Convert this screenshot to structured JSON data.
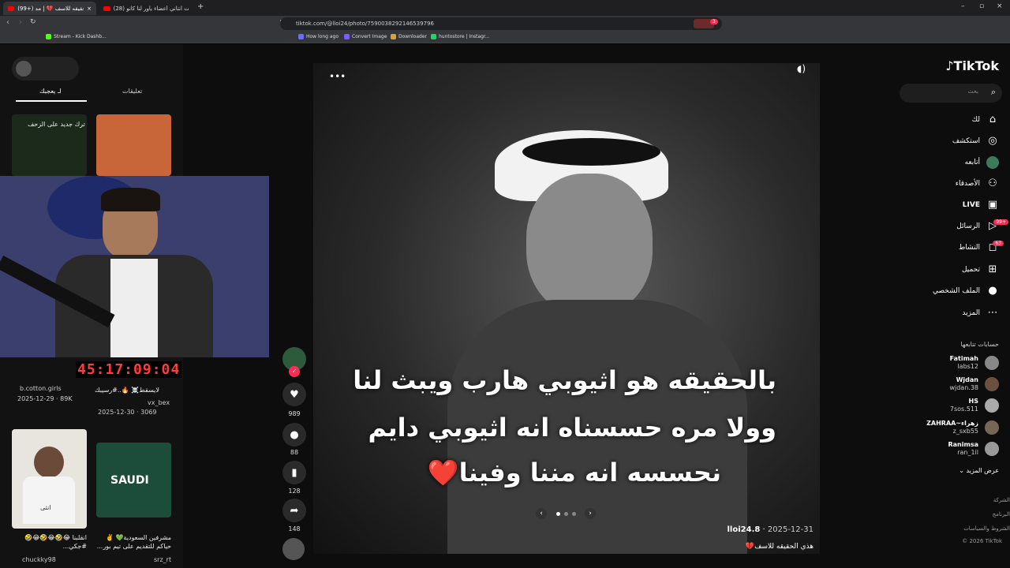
{
  "browser": {
    "tabs": [
      {
        "label": "(99+) هذي الحقيقه للاسف 💔 | مد...",
        "active": true
      },
      {
        "label": "(28) حقيقت انتاني أعضاء ياور لنا كانو ..."
      }
    ],
    "url": "tiktok.com/@lloi24/photo/7590038292146539796",
    "extension_badge": "3",
    "bookmarks": [
      "Stream - Kick Dashb...",
      "How long ago",
      "Convert Image",
      "Downloader",
      "huntostore | Instagr..."
    ]
  },
  "left_panel": {
    "tabs": [
      "لـ يعجبك",
      "تعليقات"
    ],
    "videos": [
      {
        "caption": "ترك جديد على الزحف",
        "author": "b.cotton.girls",
        "date": "2025-12-29",
        "views": "89K"
      },
      {
        "caption": "لايسقط☠️ 🔥..#رسيبك",
        "author": "vx_bex",
        "date": "2025-12-30",
        "views": "3069"
      },
      {
        "caption": "انقلبنا 😂🤣😂🤣😂🤣 #جكي...",
        "author": "chuckky98",
        "thumb_text": "انثى"
      },
      {
        "caption": "مشرفين السعودية💚 ✌️ حياكم للتقديم على تيم بور...",
        "author": "srz_rt",
        "thumb_text": "SAUDI"
      }
    ]
  },
  "stream_timer": "45:17:09:04",
  "post": {
    "caption_lines": [
      "بالحقيقه هو اثيوبي هارب ويبث لنا",
      "وولا مره حسسناه انه اثيوبي دايم",
      "نحسسه انه مننا وفينا❤️"
    ],
    "author": "lloi24.8",
    "date": "2025-12-31",
    "description": "هذي الحقيقه للاسف💔",
    "likes": "989",
    "comments": "88",
    "saves": "128",
    "shares": "148"
  },
  "sidebar": {
    "logo": "TikTok",
    "search_placeholder": "بحث",
    "nav": [
      "لك",
      "استكشف",
      "أتابعه",
      "الأصدقاء",
      "LIVE",
      "الرسائل",
      "النشاط",
      "تحميل",
      "الملف الشخصي",
      "المزيد"
    ],
    "messages_badge": "99+",
    "activity_badge": "63",
    "following_title": "حسابات تتابعها",
    "following": [
      {
        "name": "Fatimah",
        "handle": "labs12"
      },
      {
        "name": "Wjdan",
        "handle": "wjdan.38"
      },
      {
        "name": "HS",
        "handle": "7sos.511"
      },
      {
        "name": "ZAHRAA~زهراء",
        "handle": "z_sxb55"
      },
      {
        "name": "Ranimsa",
        "handle": "ran_1il"
      }
    ],
    "see_more": "عرض المزيد",
    "footer": [
      "الشركة",
      "البرنامج",
      "الشروط والسياسات",
      "© 2026 TikTok"
    ]
  },
  "colors": {
    "accent": "#fe2c55",
    "timer": "#ff3b3b"
  }
}
